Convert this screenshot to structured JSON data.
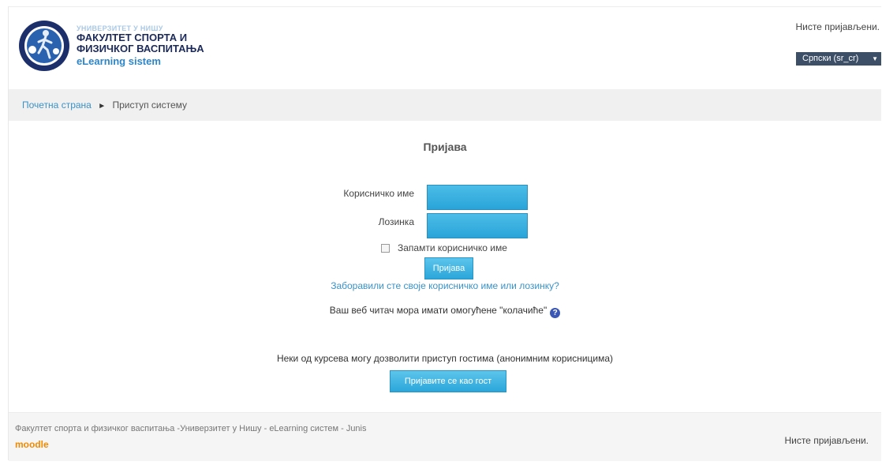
{
  "header": {
    "logo_university": "УНИВЕРЗИТЕТ У НИШУ",
    "logo_faculty_line1": "ФАКУЛТЕТ СПОРТА И",
    "logo_faculty_line2": "ФИЗИЧКОГ ВАСПИТАЊА",
    "logo_system": "eLearning sistem",
    "login_status": "Нисте пријављени.",
    "language": "Српски (sr_cr)"
  },
  "breadcrumb": {
    "home": "Почетна страна",
    "separator": "►",
    "current": "Приступ систему"
  },
  "login": {
    "title": "Пријава",
    "username_label": "Корисничко име",
    "username_value": "",
    "password_label": "Лозинка",
    "password_value": "",
    "remember_label": "Запамти корисничко име",
    "remember_checked": false,
    "submit_label": "Пријава",
    "forgot_link": "Заборавили сте своје корисничко име или лозинку?",
    "cookies_note": "Ваш веб читач мора имати омогућене \"колачиће\"",
    "guest_note": "Неки од курсева могу дозволити приступ гостима (анонимним корисницима)",
    "guest_button": "Пријавите се као гост"
  },
  "footer": {
    "text": "Факултет спорта и физичког васпитања -Универзитет у Нишу - eLearning систем - Junis",
    "moodle": "moodle",
    "login_status": "Нисте пријављени."
  },
  "colors": {
    "accent": "#2ba6da",
    "link": "#3a92c8",
    "brand_dark": "#1b2a59",
    "moodle_orange": "#f18a00"
  }
}
